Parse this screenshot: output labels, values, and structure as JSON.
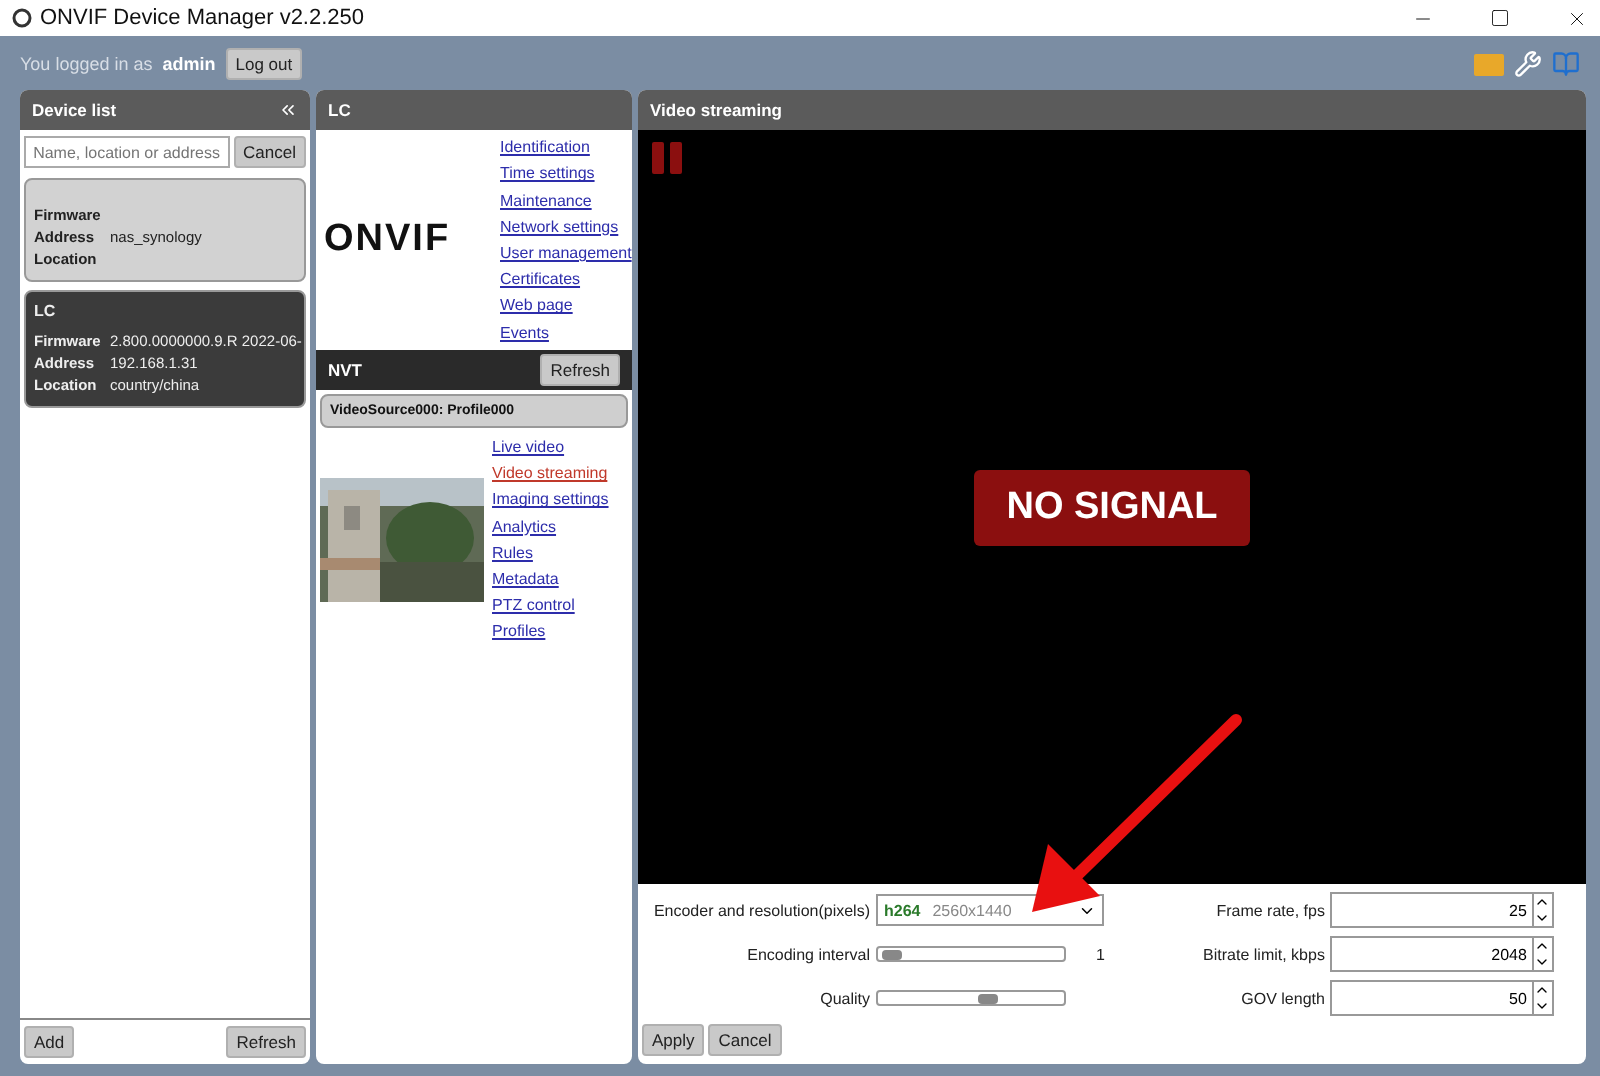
{
  "window": {
    "title": "ONVIF Device Manager v2.2.250"
  },
  "toolbar": {
    "login_prefix": "You logged in as",
    "user": "admin",
    "logout": "Log out"
  },
  "device_list": {
    "title": "Device list",
    "search": {
      "placeholder": "Name, location or address"
    },
    "cancel": "Cancel",
    "devices": [
      {
        "selected": false,
        "fields": [
          {
            "label": "Firmware"
          },
          {
            "label": "Address",
            "value": "nas_synology"
          },
          {
            "label": "Location"
          }
        ]
      },
      {
        "selected": true,
        "name": "LC",
        "fields": [
          {
            "label": "Firmware",
            "value": "2.800.0000000.9.R 2022-06-"
          },
          {
            "label": "Address",
            "value": "192.168.1.31"
          },
          {
            "label": "Location",
            "value": "country/china"
          }
        ]
      }
    ],
    "buttons": [
      "Add",
      "Refresh"
    ]
  },
  "device_panel": {
    "title": "LC",
    "logo": "ONVIF",
    "links": [
      {
        "label": "Identification",
        "selected": false
      },
      {
        "label": "Time settings",
        "selected": false
      },
      {
        "label": "Maintenance",
        "selected": false
      },
      {
        "label": "Network settings",
        "selected": false
      },
      {
        "label": "User management",
        "selected": false
      },
      {
        "label": "Certificates",
        "selected": false
      },
      {
        "label": "Web page",
        "selected": false
      },
      {
        "label": "Events",
        "selected": false
      }
    ],
    "nvt": {
      "title": "NVT",
      "refresh": "Refresh",
      "profile": "VideoSource000: Profile000",
      "links": [
        {
          "label": "Live video",
          "selected": false
        },
        {
          "label": "Video streaming",
          "selected": true
        },
        {
          "label": "Imaging settings",
          "selected": false
        },
        {
          "label": "Analytics",
          "selected": false
        },
        {
          "label": "Rules",
          "selected": false
        },
        {
          "label": "Metadata",
          "selected": false
        },
        {
          "label": "PTZ control",
          "selected": false
        },
        {
          "label": "Profiles",
          "selected": false
        }
      ]
    }
  },
  "video": {
    "title": "Video streaming",
    "status": "NO SIGNAL",
    "left_rows": [
      {
        "kind": "dropdown",
        "label": "Encoder and resolution(pixels)",
        "codec": "h264",
        "resolution": "2560x1440"
      },
      {
        "kind": "slider",
        "label": "Encoding interval",
        "level": 0.02,
        "reading": "1"
      },
      {
        "kind": "slider",
        "label": "Quality",
        "level": 0.6
      }
    ],
    "right_rows": [
      {
        "label": "Frame rate, fps",
        "value": "25"
      },
      {
        "label": "Bitrate limit, kbps",
        "value": "2048"
      },
      {
        "label": "GOV length",
        "value": "50"
      }
    ],
    "buttons": [
      "Apply",
      "Cancel"
    ]
  }
}
